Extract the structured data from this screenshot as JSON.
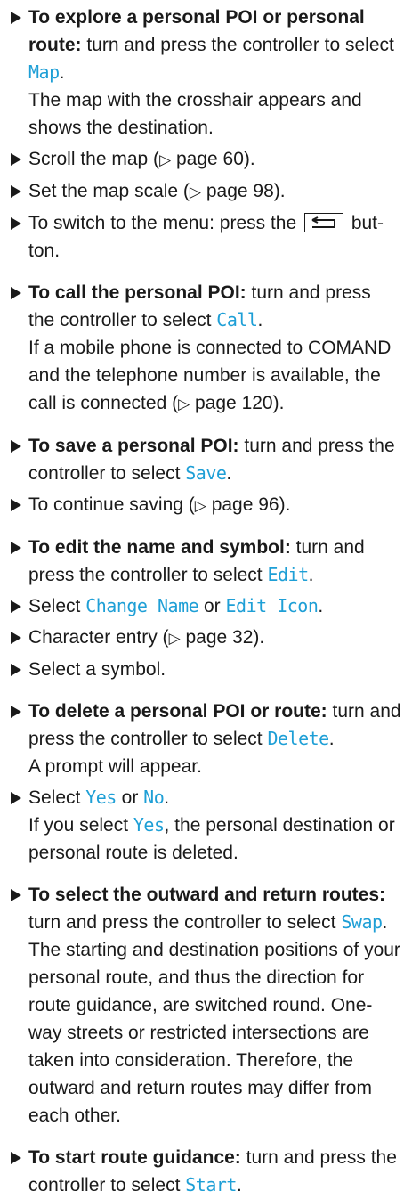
{
  "steps": [
    {
      "bold": "To explore a personal POI or personal route:",
      "pre": " turn and press the controller to select ",
      "ui": "Map",
      "post": ".",
      "result": "The map with the crosshair appears and shows the destination."
    },
    {
      "text": "Scroll the map (",
      "ref": "page 60",
      "end": ")."
    },
    {
      "text": "Set the map scale (",
      "ref": "page 98",
      "end": ")."
    },
    {
      "pre": "To switch to the menu: press the ",
      "post": " but-ton."
    },
    {
      "bold": "To call the personal POI:",
      "pre": " turn and press the controller to select ",
      "ui": "Call",
      "post": ".",
      "result_pre": "If a mobile phone is connected to COMAND and the telephone number is available, the call is connected (",
      "ref": "page 120",
      "result_post": ")."
    },
    {
      "bold": "To save a personal POI:",
      "pre": " turn and press the controller to select ",
      "ui": "Save",
      "post": "."
    },
    {
      "text": "To continue saving (",
      "ref": "page 96",
      "end": ")."
    },
    {
      "bold": "To edit the name and symbol:",
      "pre": " turn and press the controller to select ",
      "ui": "Edit",
      "post": "."
    },
    {
      "pre": "Select ",
      "ui1": "Change Name",
      "mid": " or ",
      "ui2": "Edit Icon",
      "post": "."
    },
    {
      "text": "Character entry (",
      "ref": "page 32",
      "end": ")."
    },
    {
      "text": "Select a symbol."
    },
    {
      "bold": "To delete a personal POI or route:",
      "pre": " turn and press the controller to select ",
      "ui": "Delete",
      "post": ".",
      "result": "A prompt will appear."
    },
    {
      "pre": "Select ",
      "ui1": "Yes",
      "mid": " or ",
      "ui2": "No",
      "post": ".",
      "result_pre": "If you select ",
      "result_ui": "Yes",
      "result_post": ", the personal destination or personal route is deleted."
    },
    {
      "bold": "To select the outward and return routes:",
      "pre": " turn and press the controller to select ",
      "ui": "Swap",
      "post": ".",
      "result": "The starting and destination positions of your personal route, and thus the direction for route guidance, are switched round. One-way streets or restricted intersections are taken into consideration. Therefore, the outward and return routes may differ from each other."
    },
    {
      "bold": "To start route guidance:",
      "pre": " turn and press the controller to select ",
      "ui": "Start",
      "post": "."
    }
  ],
  "icons": {
    "ref_marker": "triangle-right-outline-icon",
    "back_button": "back-arrow-icon",
    "bullet": "triangle-bullet-icon"
  },
  "colors": {
    "text": "#1a1a1a",
    "ui_term": "#1e9fd6"
  }
}
